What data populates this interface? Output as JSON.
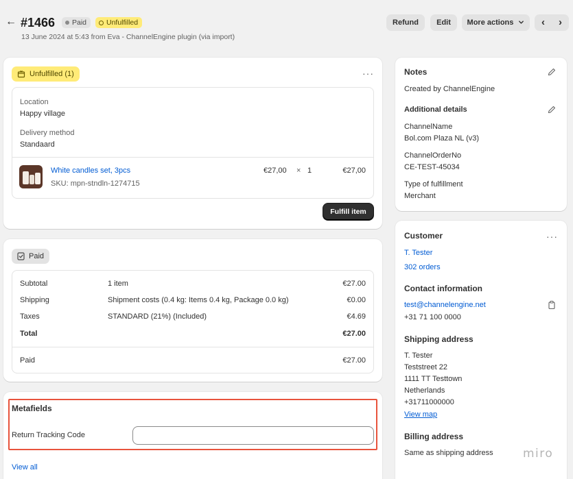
{
  "header": {
    "order_number": "#1466",
    "badge_paid": "Paid",
    "badge_unfulfilled": "Unfulfilled",
    "subtitle": "13 June 2024 at 5:43 from Eva - ChannelEngine plugin (via import)",
    "refund_label": "Refund",
    "edit_label": "Edit",
    "more_actions_label": "More actions",
    "prev_glyph": "‹",
    "next_glyph": "›"
  },
  "fulfillment": {
    "status_label": "Unfulfilled (1)",
    "location_label": "Location",
    "location_value": "Happy village",
    "delivery_label": "Delivery method",
    "delivery_value": "Standaard",
    "item": {
      "name": "White candles set, 3pcs",
      "sku": "SKU: mpn-stndln-1274715",
      "unit_price": "€27,00",
      "times": "×",
      "quantity": "1",
      "total": "€27,00"
    },
    "fulfill_button": "Fulfill item"
  },
  "payment": {
    "status_label": "Paid",
    "rows": [
      {
        "label": "Subtotal",
        "desc": "1 item",
        "amount": "€27.00"
      },
      {
        "label": "Shipping",
        "desc": "Shipment costs (0.4 kg: Items 0.4 kg, Package 0.0 kg)",
        "amount": "€0.00"
      },
      {
        "label": "Taxes",
        "desc": "STANDARD (21%) (Included)",
        "amount": "€4.69"
      },
      {
        "label": "Total",
        "desc": "",
        "amount": "€27.00"
      }
    ],
    "paid_label": "Paid",
    "paid_amount": "€27.00"
  },
  "metafields": {
    "title": "Metafields",
    "field_label": "Return Tracking Code",
    "field_value": "",
    "view_all": "View all"
  },
  "notes": {
    "title": "Notes",
    "text": "Created by ChannelEngine",
    "additional_title": "Additional details",
    "details": [
      {
        "label": "ChannelName",
        "value": "Bol.com Plaza NL (v3)"
      },
      {
        "label": "ChannelOrderNo",
        "value": "CE-TEST-45034"
      },
      {
        "label": "Type of fulfillment",
        "value": "Merchant"
      }
    ]
  },
  "customer": {
    "title": "Customer",
    "name": "T. Tester",
    "orders": "302 orders",
    "contact_title": "Contact information",
    "email": "test@channelengine.net",
    "phone": "+31 71 100 0000",
    "shipping_title": "Shipping address",
    "shipping_lines": [
      "T. Tester",
      "Teststreet 22",
      "1111 TT Testtown",
      "Netherlands",
      "+31711000000"
    ],
    "view_map": "View map",
    "billing_title": "Billing address",
    "billing_text": "Same as shipping address"
  },
  "watermark": "miro",
  "colors": {
    "background": "#f1f1f1",
    "link": "#005bd3",
    "unfulfilled_badge": "#ffeb78",
    "highlight_frame": "#e8533c"
  }
}
